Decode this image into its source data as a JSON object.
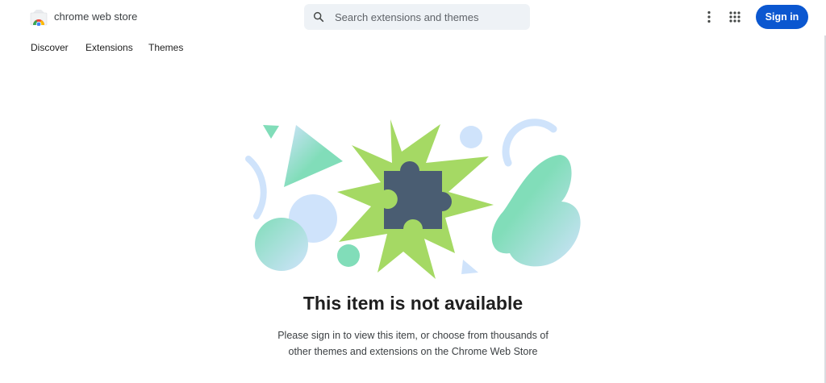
{
  "header": {
    "brand": "chrome web store",
    "search_placeholder": "Search extensions and themes",
    "signin_label": "Sign in"
  },
  "nav": {
    "items": [
      "Discover",
      "Extensions",
      "Themes"
    ]
  },
  "main": {
    "title": "This item is not available",
    "message_line1": "Please sign in to view this item, or choose from thousands of",
    "message_line2": "other themes and extensions on the Chrome Web Store"
  },
  "icons": {
    "logo": "chrome-web-store-logo",
    "search": "search-icon",
    "more": "more-vert-icon",
    "apps": "apps-grid-icon",
    "illustration": "puzzle-piece-icon"
  },
  "colors": {
    "accent": "#0b57d0",
    "burst": "#a5d964",
    "puzzle": "#4a5d72",
    "mint": "#81ddb9",
    "light_blue": "#cfe3fb"
  }
}
